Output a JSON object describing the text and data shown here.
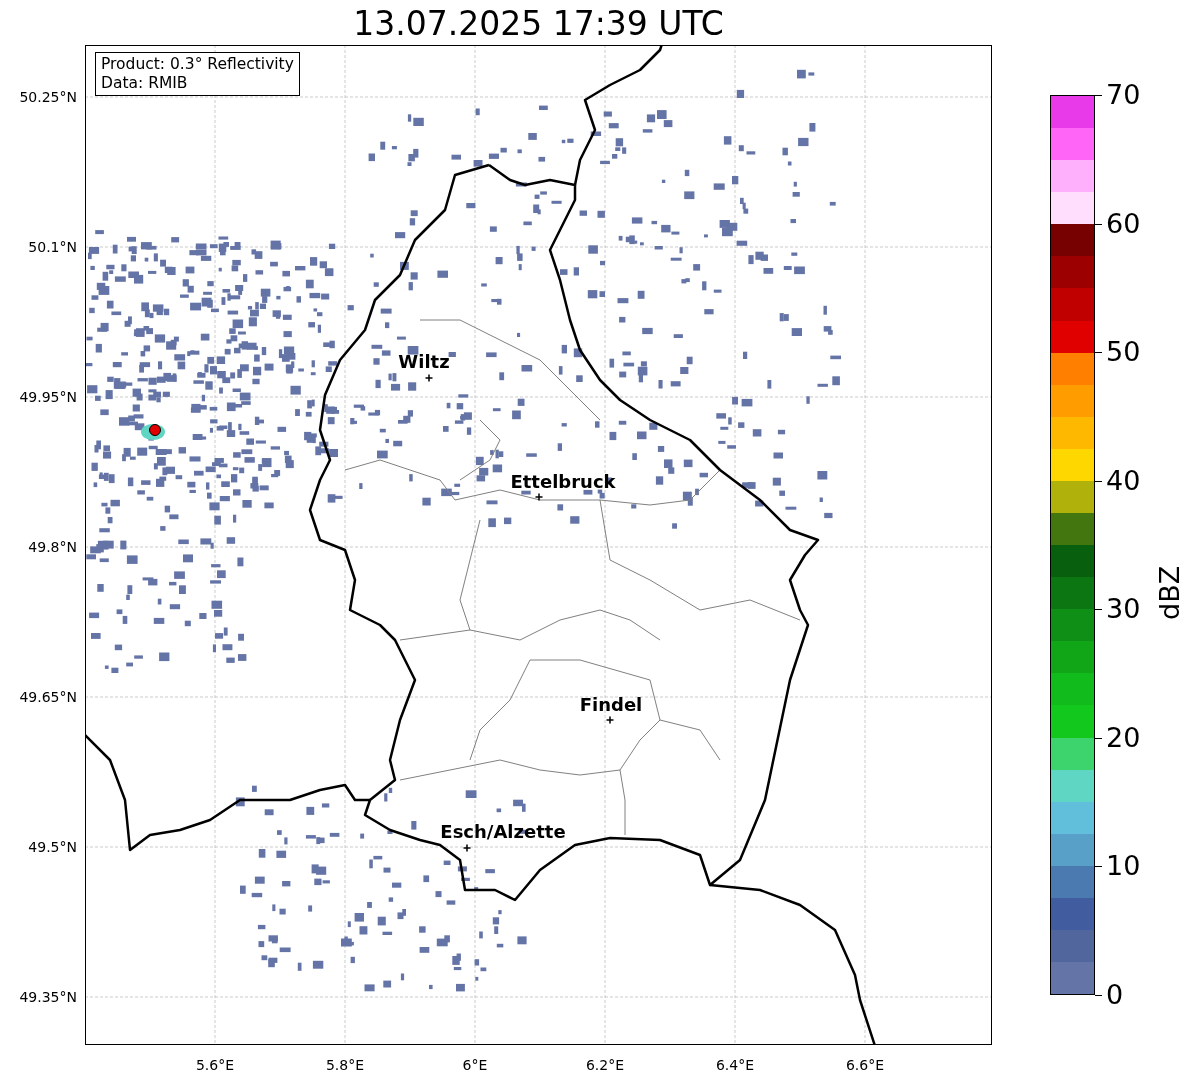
{
  "title": "13.07.2025 17:39 UTC",
  "info_box": {
    "lines": [
      "Product: 0.3° Reflectivity",
      "Data: RMIB"
    ]
  },
  "cities": [
    {
      "name": "Wiltz"
    },
    {
      "name": "Ettelbruck"
    },
    {
      "name": "Findel"
    },
    {
      "name": "Esch/Alzette"
    }
  ],
  "lat_ticks": [
    "50.25°N",
    "50.1°N",
    "49.95°N",
    "49.8°N",
    "49.65°N",
    "49.5°N",
    "49.35°N"
  ],
  "lon_ticks": [
    "5.6°E",
    "5.8°E",
    "6°E",
    "6.2°E",
    "6.4°E",
    "6.6°E"
  ],
  "colorbar": {
    "label": "dBZ",
    "ticks": [
      "70",
      "60",
      "50",
      "40",
      "30",
      "20",
      "10",
      "0"
    ],
    "bins": [
      {
        "color": "#e83ae8"
      },
      {
        "color": "#ff66f8"
      },
      {
        "color": "#ffb0fc"
      },
      {
        "color": "#ffddfd"
      },
      {
        "color": "#770000"
      },
      {
        "color": "#9c0000"
      },
      {
        "color": "#c00000"
      },
      {
        "color": "#e00000"
      },
      {
        "color": "#ff7f00"
      },
      {
        "color": "#ff9c00"
      },
      {
        "color": "#ffb800"
      },
      {
        "color": "#fed700"
      },
      {
        "color": "#b0b10a"
      },
      {
        "color": "#44760f"
      },
      {
        "color": "#085f0e"
      },
      {
        "color": "#0c7712"
      },
      {
        "color": "#0f8f16"
      },
      {
        "color": "#10a618"
      },
      {
        "color": "#12bb1c"
      },
      {
        "color": "#12c81c"
      },
      {
        "color": "#3dd46e"
      },
      {
        "color": "#5fd6c3"
      },
      {
        "color": "#62bfdc"
      },
      {
        "color": "#58a0c8"
      },
      {
        "color": "#4a7ab0"
      },
      {
        "color": "#415c9f"
      },
      {
        "color": "#52669e"
      },
      {
        "color": "#6574a6"
      }
    ]
  }
}
